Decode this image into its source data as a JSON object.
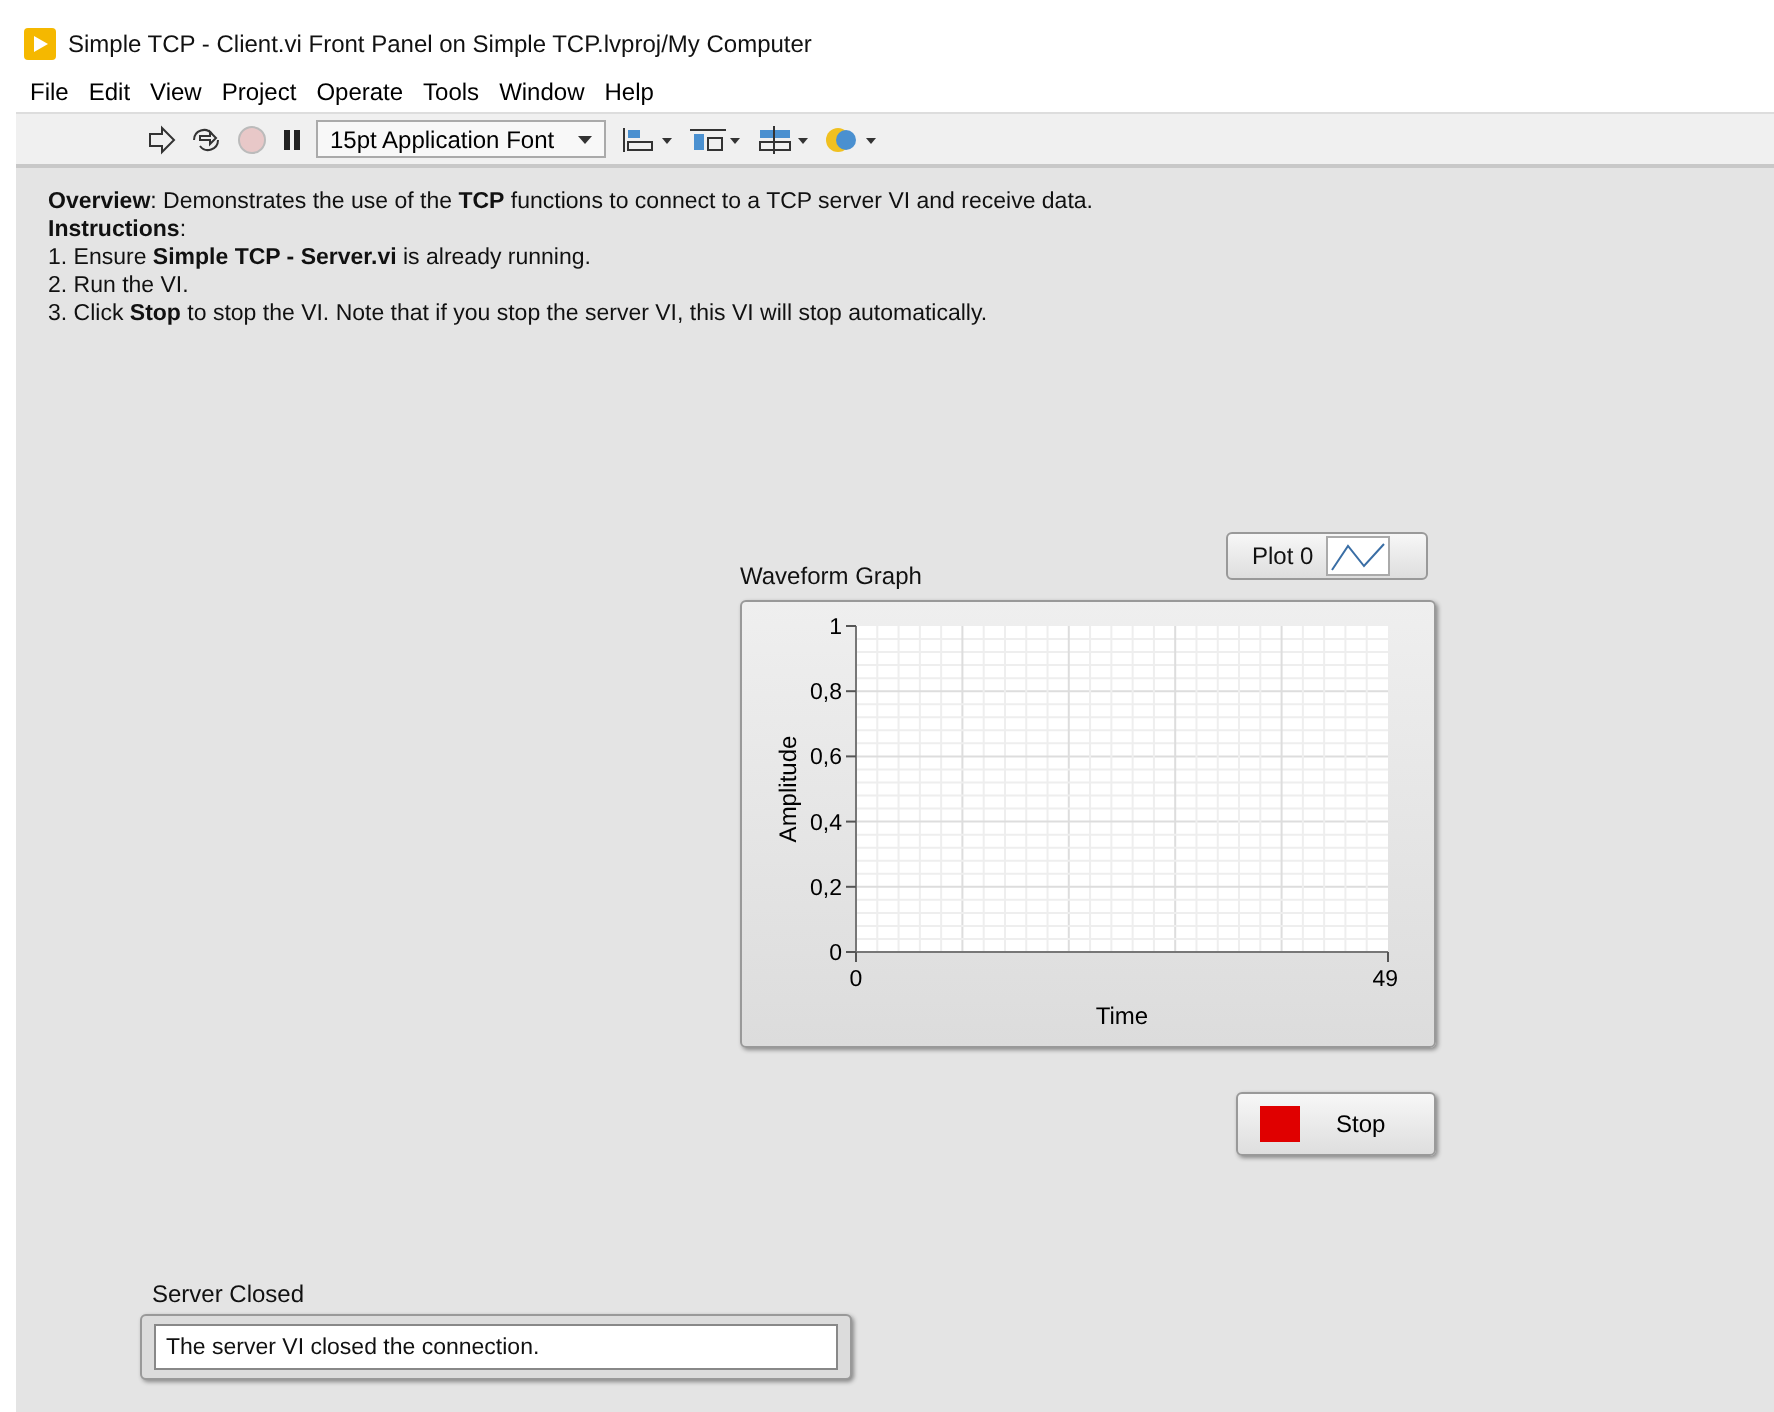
{
  "window": {
    "title": "Simple TCP - Client.vi Front Panel on Simple TCP.lvproj/My Computer"
  },
  "menu": [
    "File",
    "Edit",
    "View",
    "Project",
    "Operate",
    "Tools",
    "Window",
    "Help"
  ],
  "toolbar": {
    "font_dropdown": "15pt Application Font"
  },
  "description": [
    "**Overview**: Demonstrates the use of the **TCP** functions to connect to a TCP server VI and receive data.",
    "**Instructions**:",
    "1. Ensure **Simple TCP - Server.vi** is already running.",
    "2. Run the VI.",
    "3. Click **Stop** to stop the VI. Note that if you stop the server VI, this VI will stop automatically."
  ],
  "graph": {
    "label": "Waveform Graph",
    "legend": {
      "plot_name": "Plot 0"
    },
    "chart_data": {
      "type": "line",
      "grid": true,
      "xlabel": "Time",
      "ylabel": "Amplitude",
      "xlim": [
        0,
        49
      ],
      "ylim": [
        0,
        1
      ],
      "xticks": [
        0,
        49
      ],
      "yticks": [
        {
          "value": 0,
          "label": "0"
        },
        {
          "value": 0.2,
          "label": "0,2"
        },
        {
          "value": 0.4,
          "label": "0,4"
        },
        {
          "value": 0.6,
          "label": "0,6"
        },
        {
          "value": 0.8,
          "label": "0,8"
        },
        {
          "value": 1,
          "label": "1"
        }
      ]
    }
  },
  "stop_button": {
    "label": "Stop"
  },
  "string_indicator": {
    "label": "Server Closed",
    "value": "The server VI closed the connection."
  }
}
